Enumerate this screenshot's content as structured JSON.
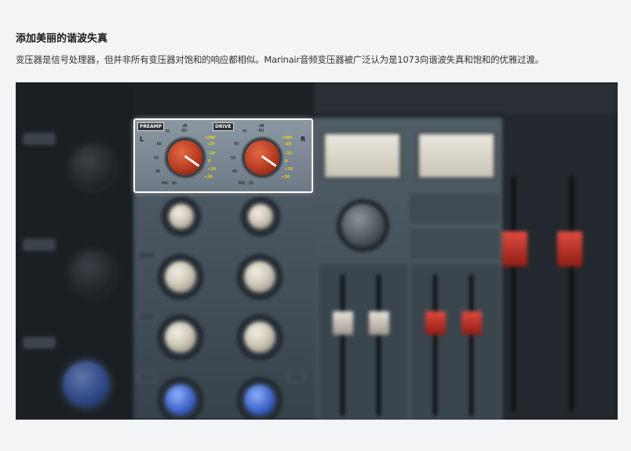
{
  "article": {
    "title": "添加美丽的谐波失真",
    "description": "变压器是信号处理器，但并非所有变压器对饱和的响应都相似。Marinair音频变压器被广泛认为是1073向谐波失真和饱和的优雅过渡。"
  },
  "figure": {
    "preamp_label": "PREAMP",
    "drive_label": "DRIVE",
    "left_channel": "L",
    "right_channel": "R",
    "scale_left": [
      "70",
      "60",
      "50",
      "40",
      "MIC. 30"
    ],
    "scale_top": [
      "dB",
      "-80"
    ],
    "scale_line": [
      "LINE",
      "-20",
      "-10",
      "0",
      "+10",
      "+20"
    ]
  }
}
